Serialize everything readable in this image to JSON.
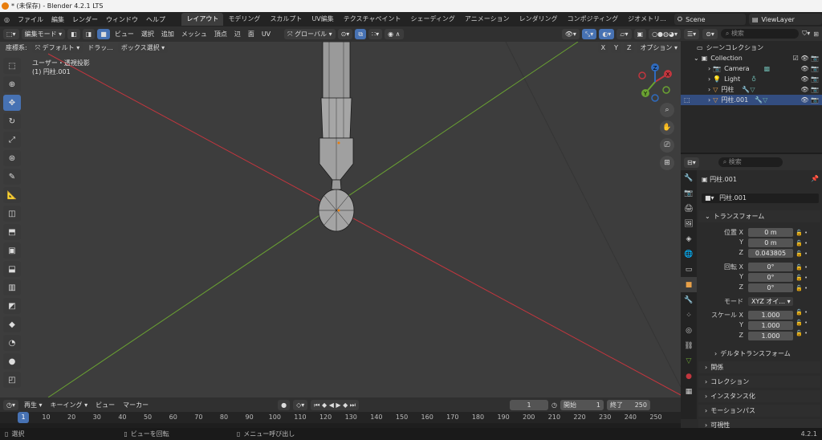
{
  "window": {
    "title": "* (未保存) - Blender 4.2.1 LTS"
  },
  "menu": {
    "items": [
      "ファイル",
      "編集",
      "レンダー",
      "ウィンドウ",
      "ヘルプ"
    ]
  },
  "workspaces": [
    "レイアウト",
    "モデリング",
    "スカルプト",
    "UV編集",
    "テクスチャペイント",
    "シェーディング",
    "アニメーション",
    "レンダリング",
    "コンポジティング",
    "ジオメトリ..."
  ],
  "scene": {
    "name": "Scene",
    "view_layer": "ViewLayer"
  },
  "viewport_header": {
    "mode": "編集モード",
    "menus": [
      "ビュー",
      "選択",
      "追加",
      "メッシュ",
      "頂点",
      "辺",
      "面",
      "UV"
    ],
    "orientation": "グローバル"
  },
  "viewport_header2": {
    "coord_label": "座標系:",
    "coord_value": "デフォルト",
    "drag_label": "ドラッ...",
    "select_mode": "ボックス選択",
    "axes": [
      "X",
      "Y",
      "Z"
    ],
    "options": "オプション"
  },
  "viewport": {
    "view_name": "ユーザー・透視投影",
    "object_name": "(1) 円柱.001"
  },
  "gizmo": {
    "x": "X",
    "y": "Y",
    "z": "Z"
  },
  "outliner": {
    "search_placeholder": "検索",
    "scene_collection": "シーンコレクション",
    "collection": "Collection",
    "items": [
      "Camera",
      "Light",
      "円柱",
      "円柱.001"
    ]
  },
  "properties": {
    "search_placeholder": "検索",
    "object_title": "円柱.001",
    "object_name_field": "円柱.001",
    "transform_header": "トランスフォーム",
    "location_label": "位置 X",
    "rotation_label": "回転 X",
    "scale_label": "スケール X",
    "y_label": "Y",
    "z_label": "Z",
    "location": [
      "0 m",
      "0 m",
      "0.043805"
    ],
    "rotation": [
      "0°",
      "0°",
      "0°"
    ],
    "mode_label": "モード",
    "mode_value": "XYZ オイ...",
    "scale": [
      "1.000",
      "1.000",
      "1.000"
    ],
    "delta_header": "デルタトランスフォーム",
    "panels": [
      "関係",
      "コレクション",
      "インスタンス化",
      "モーションパス",
      "可視性"
    ]
  },
  "timeline": {
    "playback": "再生",
    "keying": "キーイング",
    "view": "ビュー",
    "marker": "マーカー",
    "current_frame": "1",
    "start_label": "開始",
    "start_value": "1",
    "end_label": "終了",
    "end_value": "250",
    "ticks": [
      "1",
      "10",
      "20",
      "30",
      "40",
      "50",
      "60",
      "70",
      "80",
      "90",
      "100",
      "110",
      "120",
      "130",
      "140",
      "150",
      "160",
      "170",
      "180",
      "190",
      "200",
      "210",
      "220",
      "230",
      "240",
      "250"
    ]
  },
  "statusbar": {
    "select": "選択",
    "rotate": "ビューを回転",
    "menu": "メニュー呼び出し",
    "version": "4.2.1"
  },
  "colors": {
    "accent": "#4772b3",
    "viewport_bg": "#3d3d3d",
    "x_axis": "#c2363e",
    "y_axis": "#6aa232"
  }
}
